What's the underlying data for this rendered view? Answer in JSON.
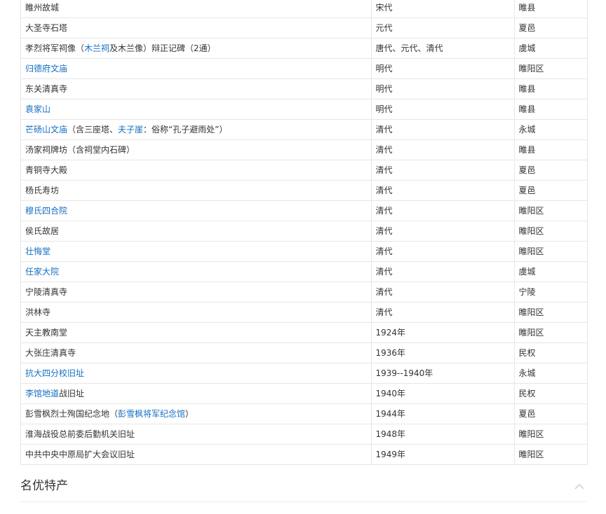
{
  "rows": [
    {
      "name": [
        {
          "t": "睢州故城"
        }
      ],
      "era": "宋代",
      "loc": "睢县"
    },
    {
      "name": [
        {
          "t": "大圣寺石塔"
        }
      ],
      "era": "元代",
      "loc": "夏邑"
    },
    {
      "name": [
        {
          "t": "孝烈将军祠像（"
        },
        {
          "t": "木兰祠",
          "link": true
        },
        {
          "t": "及木兰像）辩正记碑（2通）"
        }
      ],
      "era": "唐代、元代、清代",
      "loc": "虞城"
    },
    {
      "name": [
        {
          "t": "归德府文庙",
          "link": true
        }
      ],
      "era": "明代",
      "loc": "睢阳区"
    },
    {
      "name": [
        {
          "t": "东关清真寺"
        }
      ],
      "era": "明代",
      "loc": "睢县"
    },
    {
      "name": [
        {
          "t": "袁家山",
          "link": true
        }
      ],
      "era": "明代",
      "loc": "睢县"
    },
    {
      "name": [
        {
          "t": "芒砀山文庙",
          "link": true
        },
        {
          "t": "（含三座塔、"
        },
        {
          "t": "夫子崖",
          "link": true
        },
        {
          "t": "：俗称“孔子避雨处”）"
        }
      ],
      "era": "清代",
      "loc": "永城"
    },
    {
      "name": [
        {
          "t": "汤家祠牌坊（含祠堂内石碑）"
        }
      ],
      "era": "清代",
      "loc": "睢县"
    },
    {
      "name": [
        {
          "t": "青铜寺大殿"
        }
      ],
      "era": "清代",
      "loc": "夏邑"
    },
    {
      "name": [
        {
          "t": "杨氏寿坊"
        }
      ],
      "era": "清代",
      "loc": "夏邑"
    },
    {
      "name": [
        {
          "t": "穆氏四合院",
          "link": true
        }
      ],
      "era": "清代",
      "loc": "睢阳区"
    },
    {
      "name": [
        {
          "t": "侯氏故居"
        }
      ],
      "era": "清代",
      "loc": "睢阳区"
    },
    {
      "name": [
        {
          "t": "壮悔堂",
          "link": true
        }
      ],
      "era": "清代",
      "loc": "睢阳区"
    },
    {
      "name": [
        {
          "t": "任家大院",
          "link": true
        }
      ],
      "era": "清代",
      "loc": "虞城"
    },
    {
      "name": [
        {
          "t": "宁陵清真寺"
        }
      ],
      "era": "清代",
      "loc": "宁陵"
    },
    {
      "name": [
        {
          "t": "洪林寺"
        }
      ],
      "era": "清代",
      "loc": "睢阳区"
    },
    {
      "name": [
        {
          "t": "天主教南堂"
        }
      ],
      "era": "1924年",
      "loc": "睢阳区"
    },
    {
      "name": [
        {
          "t": "大张庄清真寺"
        }
      ],
      "era": "1936年",
      "loc": "民权"
    },
    {
      "name": [
        {
          "t": "抗大四分校旧址",
          "link": true
        }
      ],
      "era": "1939--1940年",
      "loc": "永城"
    },
    {
      "name": [
        {
          "t": "李馆地道",
          "link": true
        },
        {
          "t": "战旧址"
        }
      ],
      "era": "1940年",
      "loc": "民权"
    },
    {
      "name": [
        {
          "t": "彭雪枫烈士殉国纪念地（"
        },
        {
          "t": "彭雪枫将军纪念馆",
          "link": true
        },
        {
          "t": "）"
        }
      ],
      "era": "1944年",
      "loc": "夏邑"
    },
    {
      "name": [
        {
          "t": "淮海战役总前委后勤机关旧址"
        }
      ],
      "era": "1948年",
      "loc": "睢阳区"
    },
    {
      "name": [
        {
          "t": "中共中央中原局扩大会议旧址"
        }
      ],
      "era": "1949年",
      "loc": "睢阳区"
    }
  ],
  "section": {
    "title": "名优特产",
    "collapse_icon": "chevron-up-icon"
  },
  "colors": {
    "link": "#136ec2",
    "text": "#333333",
    "border": "#e6e6e6"
  }
}
